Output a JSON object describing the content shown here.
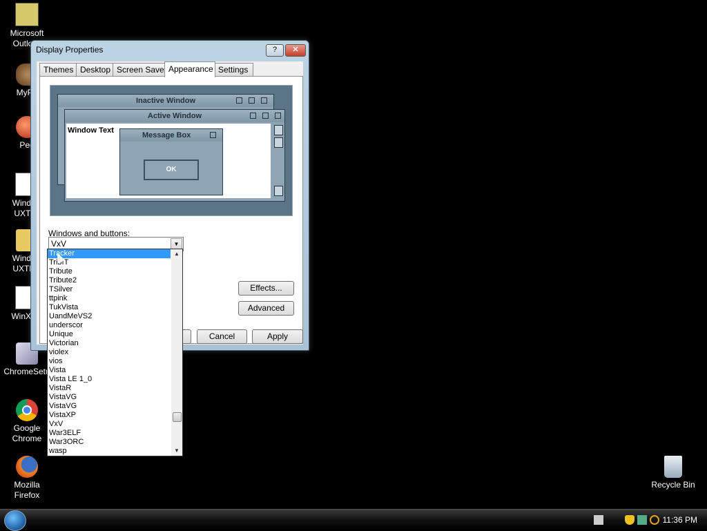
{
  "desktop": {
    "icons": [
      {
        "label": "Microsoft Outlo…",
        "name": "outlook-icon"
      },
      {
        "label": "MyPa",
        "name": "mypa-icon"
      },
      {
        "label": "Peg",
        "name": "peg-icon"
      },
      {
        "label": "Window UXThe",
        "name": "uxtheme-file-icon"
      },
      {
        "label": "Window UXTher",
        "name": "uxtheme-folder-icon"
      },
      {
        "label": "WinXPR",
        "name": "winxpr-icon"
      },
      {
        "label": "ChromeSetu",
        "name": "chrome-setup-icon"
      },
      {
        "label": "Google Chrome",
        "name": "google-chrome-icon"
      },
      {
        "label": "Mozilla Firefox",
        "name": "firefox-icon"
      },
      {
        "label": "Recycle Bin",
        "name": "recycle-bin-icon"
      }
    ]
  },
  "window": {
    "title": "Display Properties",
    "help": "?",
    "close": "✕",
    "tabs": [
      "Themes",
      "Desktop",
      "Screen Saver",
      "Appearance",
      "Settings"
    ],
    "active_tab": "Appearance"
  },
  "preview": {
    "inactive": "Inactive Window",
    "active": "Active Window",
    "window_text": "Window Text",
    "message_box": "Message Box",
    "ok": "OK"
  },
  "controls": {
    "windows_buttons_label": "Windows and buttons:",
    "combo_value": "VxV",
    "effects": "Effects...",
    "advanced": "Advanced",
    "cancel": "Cancel",
    "apply": "Apply"
  },
  "dropdown": {
    "items": [
      "Tracker",
      "TribIT",
      "Tribute",
      "Tribute2",
      "TSilver",
      "ttpink",
      "TukVista",
      "UandMeVS2",
      "underscor",
      "Unique",
      "Victorian",
      "violex",
      "vios",
      "Vista",
      "Vista LE 1_0",
      "VistaR",
      "VistaVG",
      "VistaVG",
      "VistaXP",
      "VxV",
      "War3ELF",
      "War3ORC",
      "wasp"
    ],
    "selected_index": 0
  },
  "taskbar": {
    "clock": "11:36 PM"
  }
}
